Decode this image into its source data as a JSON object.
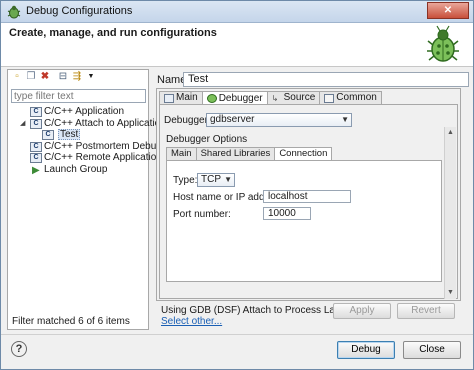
{
  "window": {
    "title": "Debug Configurations"
  },
  "header": {
    "heading": "Create, manage, and run configurations"
  },
  "left": {
    "filter_placeholder": "type filter text",
    "tree": [
      {
        "label": "C/C++ Application",
        "level": 0,
        "icon": "c-config-icon"
      },
      {
        "label": "C/C++ Attach to Application",
        "level": 0,
        "icon": "c-config-icon",
        "expanded": true
      },
      {
        "label": "Test",
        "level": 1,
        "icon": "c-config-icon",
        "selected": true
      },
      {
        "label": "C/C++ Postmortem Debugger",
        "level": 0,
        "icon": "c-config-icon"
      },
      {
        "label": "C/C++ Remote Application",
        "level": 0,
        "icon": "c-config-icon"
      },
      {
        "label": "Launch Group",
        "level": 0,
        "icon": "launch-group-icon"
      }
    ],
    "status": "Filter matched 6 of 6 items"
  },
  "name": {
    "label": "Name:",
    "value": "Test"
  },
  "tabs": [
    "Main",
    "Debugger",
    "Source",
    "Common"
  ],
  "active_tab": "Debugger",
  "debugger": {
    "label": "Debugger:",
    "value": "gdbserver",
    "options_label": "Debugger Options",
    "subtabs": [
      "Main",
      "Shared Libraries",
      "Connection"
    ],
    "active_subtab": "Connection",
    "type_label": "Type:",
    "type_value": "TCP",
    "host_label": "Host name or IP address:",
    "host_value": "localhost",
    "port_label": "Port number:",
    "port_value": "10000"
  },
  "launcher": {
    "text": "Using GDB (DSF) Attach to Process Launcher -",
    "link": "Select other..."
  },
  "buttons": {
    "apply": "Apply",
    "revert": "Revert",
    "debug": "Debug",
    "close": "Close",
    "help": "?"
  },
  "colors": {
    "accent": "#3c7fb1",
    "link": "#1a5fb4"
  }
}
